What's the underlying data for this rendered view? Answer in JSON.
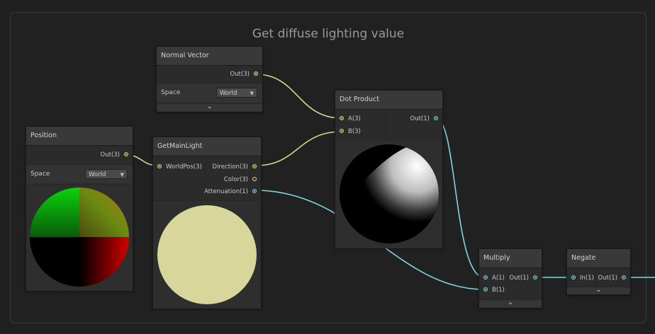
{
  "group": {
    "title": "Get diffuse lighting value"
  },
  "nodes": {
    "normal_vector": {
      "title": "Normal Vector",
      "out": "Out(3)",
      "space_label": "Space",
      "space_value": "World"
    },
    "position": {
      "title": "Position",
      "out": "Out(3)",
      "space_label": "Space",
      "space_value": "World"
    },
    "get_main_light": {
      "title": "GetMainLight",
      "in": "WorldPos(3)",
      "outs": [
        "Direction(3)",
        "Color(3)",
        "Attenuation(1)"
      ]
    },
    "dot_product": {
      "title": "Dot Product",
      "ins": [
        "A(3)",
        "B(3)"
      ],
      "out": "Out(1)"
    },
    "multiply": {
      "title": "Multiply",
      "ins": [
        "A(1)",
        "B(1)"
      ],
      "out": "Out(1)"
    },
    "negate": {
      "title": "Negate",
      "in": "In(1)",
      "out": "Out(1)"
    }
  },
  "icons": {
    "expand": "chevron-down-icon",
    "dropdown": "triangle-down-icon"
  },
  "colors": {
    "vector3_wire": "#d9d98a",
    "vector1_wire": "#7ed7de",
    "light_color_preview": "#d9d69b"
  }
}
